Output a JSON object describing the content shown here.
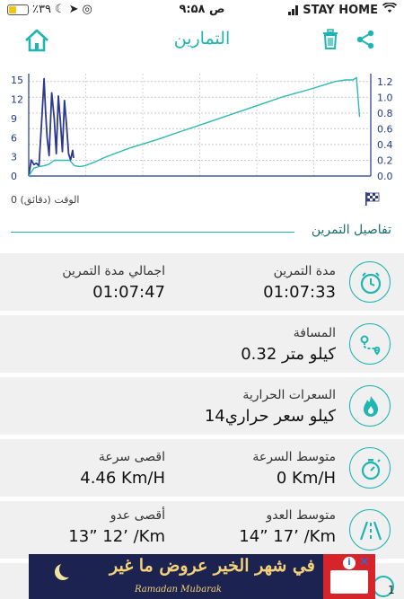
{
  "status_bar": {
    "battery_text": "٪۳۹",
    "time": "۹:۵۸ ص",
    "carrier": "STAY HOME"
  },
  "header": {
    "title": "التمارين",
    "share_icon": "share-icon",
    "delete_icon": "trash-icon",
    "home_icon": "home-icon",
    "accent_color": "#1fb5b0"
  },
  "chart_data": {
    "type": "line",
    "xlabel": "0 الوقت (دقائق)",
    "left_axis": {
      "ticks": [
        "15",
        "12",
        "9",
        "6",
        "3",
        "0"
      ],
      "ylim": [
        0,
        16
      ]
    },
    "right_axis": {
      "ticks": [
        "1.2",
        "1.0",
        "0.8",
        "0.6",
        "0.4",
        "0.2",
        "0.0"
      ],
      "ylim": [
        0,
        1.3
      ]
    },
    "xlim": [
      0,
      67
    ],
    "grid": true,
    "series": [
      {
        "axis": "left",
        "color": "#2d3a8c",
        "x": [
          0,
          0.5,
          1.0,
          1.5,
          2.0,
          2.5,
          3.0,
          3.3,
          3.6,
          4.0,
          4.5,
          5.0,
          5.4,
          5.8,
          6.2,
          6.6,
          7.0,
          7.4,
          7.8,
          8.2,
          8.6,
          8.8
        ],
        "y": [
          0,
          2.5,
          1.8,
          2.0,
          1.6,
          8.0,
          15.2,
          10.0,
          6.0,
          3.2,
          13.0,
          9.0,
          3.5,
          12.5,
          8.5,
          3.8,
          11.8,
          8.0,
          3.5,
          2.5,
          4.0,
          2.8
        ]
      },
      {
        "axis": "right",
        "color": "#2fb8b2",
        "x": [
          0,
          0.5,
          1.0,
          2.0,
          3.0,
          4.0,
          5.0,
          6.0,
          7.0,
          8.0,
          9.0,
          10.0,
          11.0,
          13.0,
          15.0,
          20.0,
          25.0,
          30.0,
          35.0,
          40.0,
          45.0,
          50.0,
          55.0,
          58.0,
          60.0,
          62.0,
          63.5,
          64.2,
          64.8
        ],
        "y": [
          0.0,
          0.05,
          0.1,
          0.12,
          0.13,
          0.15,
          0.2,
          0.2,
          0.2,
          0.2,
          0.13,
          0.12,
          0.13,
          0.18,
          0.24,
          0.36,
          0.46,
          0.57,
          0.68,
          0.79,
          0.9,
          1.01,
          1.1,
          1.16,
          1.2,
          1.22,
          1.22,
          1.25,
          0.75
        ]
      }
    ]
  },
  "section": {
    "title": "تفاصيل التمرين"
  },
  "stats": [
    {
      "icon": "timer-icon",
      "right_label": "مدة التمرين",
      "right_value": "01:07:33",
      "left_label": "اجمالي مدة التمرين",
      "left_value": "01:07:47"
    },
    {
      "icon": "route-map-icon",
      "right_label": "المسافة",
      "right_value": "0.32 كيلو متر"
    },
    {
      "icon": "flame-icon",
      "right_label": "السعرات الحرارية",
      "right_value": "14كيلو  سعر حراري"
    },
    {
      "icon": "speedometer-icon",
      "right_label": "متوسط السرعة",
      "right_value": "0 Km/H",
      "left_label": "اقصى سرعة",
      "left_value": "4.46 Km/H"
    },
    {
      "icon": "road-icon",
      "right_label": "متوسط العدو",
      "right_value": "14” 17’ /Km",
      "left_label": "أقصى عدو",
      "left_value": "13” 12’ /Km"
    }
  ],
  "ad": {
    "headline": "في شهر الخير عروض ما غير",
    "subline": "Ramadan Mubarak",
    "info_glyph": "i",
    "close_glyph": "✕"
  },
  "page_badge": "1"
}
